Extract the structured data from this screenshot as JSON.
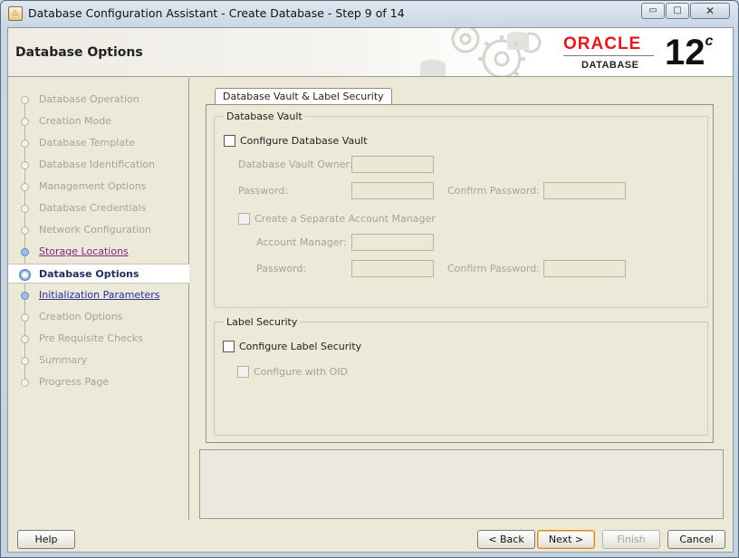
{
  "window": {
    "title": "Database Configuration Assistant - Create Database - Step 9 of 14",
    "minimize": "▭",
    "maximize": "□",
    "close": "✕"
  },
  "header": {
    "page_title": "Database Options",
    "brand": "ORACLE",
    "brand_sub": "DATABASE",
    "version": "12",
    "version_sup": "c"
  },
  "nav": {
    "items": [
      {
        "label": "Database Operation",
        "state": "done"
      },
      {
        "label": "Creation Mode",
        "state": "done"
      },
      {
        "label": "Database Template",
        "state": "done"
      },
      {
        "label": "Database Identification",
        "state": "done"
      },
      {
        "label": "Management Options",
        "state": "done"
      },
      {
        "label": "Database Credentials",
        "state": "done"
      },
      {
        "label": "Network Configuration",
        "state": "done"
      },
      {
        "label": "Storage Locations",
        "state": "visited"
      },
      {
        "label": "Database Options",
        "state": "current"
      },
      {
        "label": "Initialization Parameters",
        "state": "link"
      },
      {
        "label": "Creation Options",
        "state": "pending"
      },
      {
        "label": "Pre Requisite Checks",
        "state": "pending"
      },
      {
        "label": "Summary",
        "state": "pending"
      },
      {
        "label": "Progress Page",
        "state": "pending"
      }
    ]
  },
  "tab": {
    "label": "Database Vault & Label Security"
  },
  "vault": {
    "legend": "Database Vault",
    "configure_label": "Configure Database Vault",
    "configure_checked": false,
    "owner_label": "Database Vault Owner:",
    "owner_value": "",
    "password_label": "Password:",
    "password_value": "",
    "confirm_label": "Confirm Password:",
    "confirm_value": "",
    "separate_manager_label": "Create a Separate Account Manager",
    "separate_manager_checked": false,
    "account_manager_label": "Account Manager:",
    "account_manager_value": "",
    "manager_password_label": "Password:",
    "manager_password_value": "",
    "manager_confirm_label": "Confirm Password:",
    "manager_confirm_value": ""
  },
  "label_security": {
    "legend": "Label Security",
    "configure_label": "Configure Label Security",
    "configure_checked": false,
    "oid_label": "Configure with OID",
    "oid_checked": false
  },
  "buttons": {
    "help": "Help",
    "back": "< Back",
    "next": "Next >",
    "finish": "Finish",
    "cancel": "Cancel"
  }
}
